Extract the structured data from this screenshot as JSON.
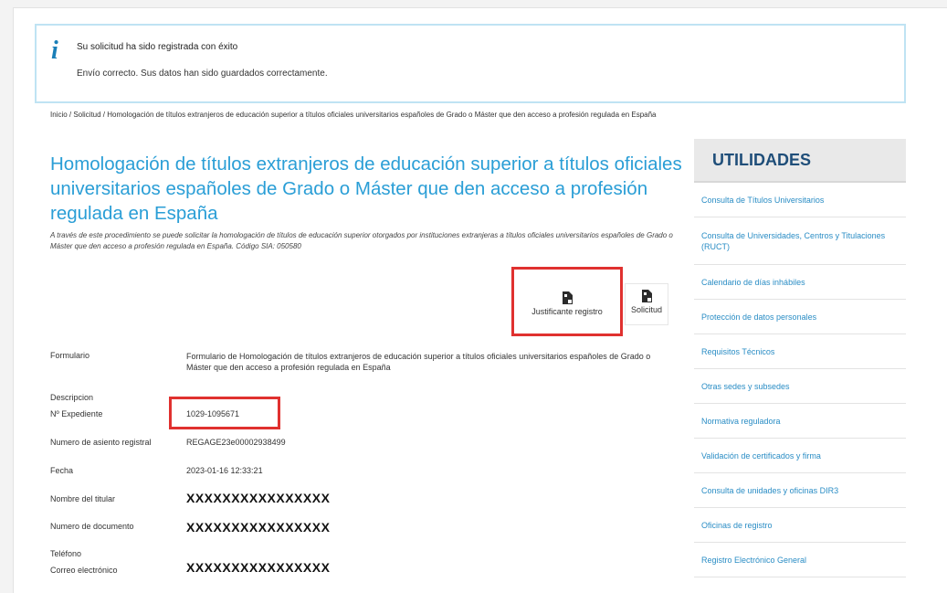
{
  "alert": {
    "title": "Su solicitud ha sido registrada con éxito",
    "message": "Envío correcto. Sus datos han sido guardados correctamente.",
    "icon": "info-icon"
  },
  "breadcrumb": "Inicio / Solicitud / Homologación de títulos extranjeros de educación superior a títulos oficiales universitarios españoles de Grado o Máster que den acceso a profesión regulada en España",
  "title": "Homologación de títulos extranjeros de educación superior a títulos oficiales universitarios españoles de Grado o Máster que den acceso a profesión regulada en España",
  "description": "A través de este procedimiento se puede solicitar la homologación de títulos de educación superior otorgados por instituciones extranjeras a títulos oficiales universitarios españoles de Grado o Máster que den acceso a profesión regulada en España. Código SIA: 050580",
  "buttons": {
    "justificante": "Justificante registro",
    "solicitud": "Solicitud",
    "icon": "pdf-document-icon"
  },
  "fields": {
    "formulario_label": "Formulario",
    "formulario_value": "Formulario de Homologación de títulos extranjeros de educación superior a títulos oficiales universitarios españoles de Grado o Máster que den acceso a profesión regulada en España",
    "descripcion_label": "Descripcion",
    "expediente_label": "Nº Expediente",
    "expediente_value": "1029-1095671",
    "asiento_label": "Numero de asiento registral",
    "asiento_value": "REGAGE23e00002938499",
    "fecha_label": "Fecha",
    "fecha_value": "2023-01-16 12:33:21",
    "titular_label": "Nombre del titular",
    "titular_value": "XXXXXXXXXXXXXXXX",
    "documento_label": "Numero de documento",
    "documento_value": "XXXXXXXXXXXXXXXX",
    "telefono_label": "Teléfono",
    "correo_label": "Correo electrónico",
    "correo_value": "XXXXXXXXXXXXXXXX"
  },
  "sidebar": {
    "title": "UTILIDADES",
    "items": [
      "Consulta de Títulos Universitarios",
      "Consulta de Universidades, Centros y Titulaciones (RUCT)",
      "Calendario de días inhábiles",
      "Protección de datos personales",
      "Requisitos Técnicos",
      "Otras sedes y subsedes",
      "Normativa reguladora",
      "Validación de certificados y firma",
      "Consulta de unidades y oficinas DIR3",
      "Oficinas de registro",
      "Registro Electrónico General"
    ]
  },
  "colors": {
    "title_blue": "#2a9ed6",
    "link_blue": "#2a8dc5",
    "highlight_red": "#e0312f",
    "sidebar_head": "#1f4e79"
  }
}
